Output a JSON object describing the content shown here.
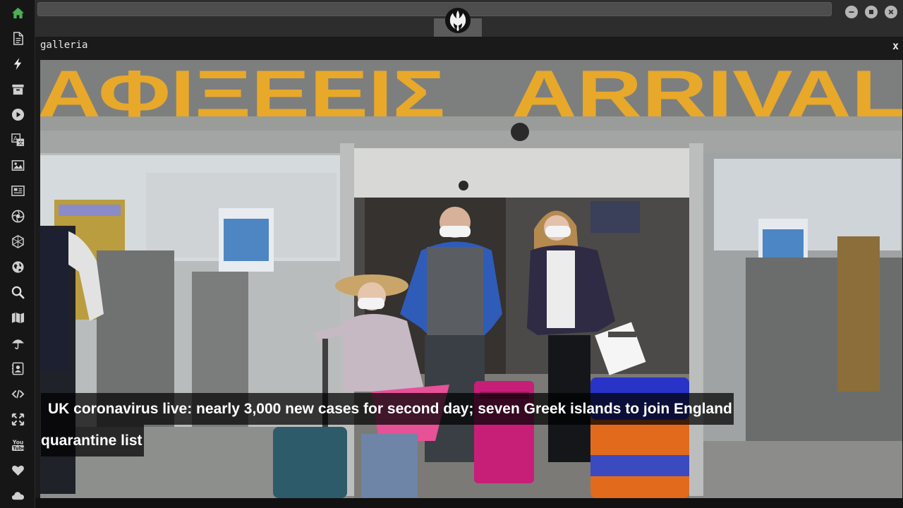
{
  "sidebar": {
    "items": [
      {
        "icon": "home-icon",
        "active": true
      },
      {
        "icon": "document-icon"
      },
      {
        "icon": "lightning-icon"
      },
      {
        "icon": "archive-icon"
      },
      {
        "icon": "play-icon"
      },
      {
        "icon": "translate-icon"
      },
      {
        "icon": "image-icon"
      },
      {
        "icon": "newspaper-icon"
      },
      {
        "icon": "aperture-icon"
      },
      {
        "icon": "hexagon-icon"
      },
      {
        "icon": "globe-icon"
      },
      {
        "icon": "search-icon"
      },
      {
        "icon": "map-icon"
      },
      {
        "icon": "umbrella-icon"
      },
      {
        "icon": "contact-icon"
      },
      {
        "icon": "code-icon"
      },
      {
        "icon": "expand-icon"
      },
      {
        "icon": "youtube-icon"
      },
      {
        "icon": "heart-icon"
      },
      {
        "icon": "cloud-icon"
      }
    ],
    "active_color": "#4caf50"
  },
  "topbar": {
    "logo_icon": "rebel-alliance-icon",
    "window_controls": [
      "minimize-icon",
      "maximize-icon",
      "close-icon"
    ]
  },
  "gallery": {
    "title": "galleria",
    "close_label": "x",
    "sign_text_greek": "ΑΦΙΞΕΕΙΣ",
    "sign_text_english": "ARRIVAL",
    "caption_line1": "UK coronavirus live: nearly 3,000 new cases for second day; seven Greek islands to join England",
    "caption_line2": "quarantine list"
  }
}
